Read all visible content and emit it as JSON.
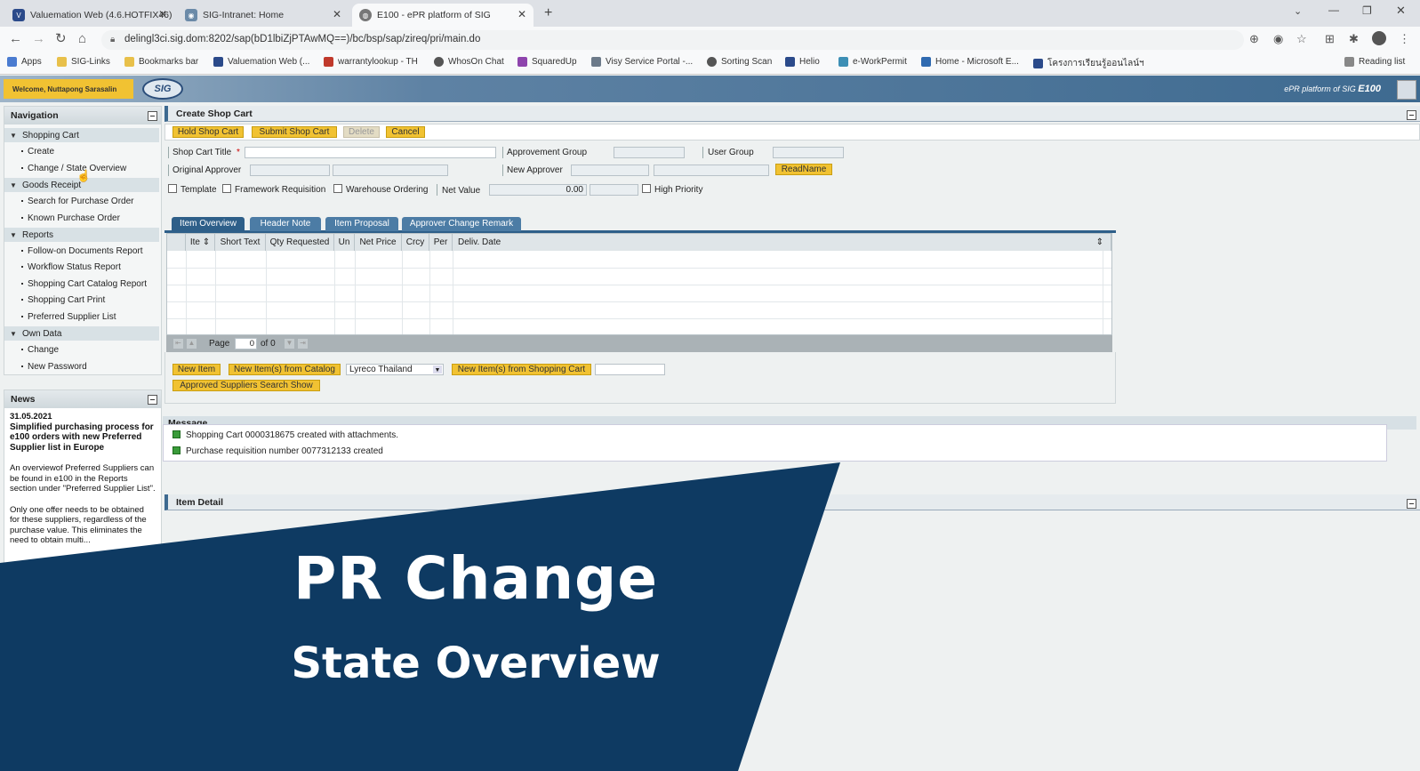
{
  "browser": {
    "tabs": [
      {
        "title": "Valuemation Web (4.6.HOTFIX46)",
        "favicon": "V"
      },
      {
        "title": "SIG-Intranet: Home",
        "favicon": "SIG"
      },
      {
        "title": "E100 - ePR platform of SIG",
        "favicon": "globe"
      }
    ],
    "url": "delingl3ci.sig.dom:8202/sap(bD1lbiZjPTAwMQ==)/bc/bsp/sap/zireq/pri/main.do",
    "bookmarks": [
      "Apps",
      "SIG-Links",
      "Bookmarks bar",
      "Valuemation Web (...",
      "warrantylookup - TH",
      "WhosOn Chat",
      "SquaredUp",
      "Visy Service Portal -...",
      "Sorting Scan",
      "Helio",
      "e-WorkPermit",
      "Home - Microsoft E...",
      "โครงการเรียนรู้ออนไลน์ฯ"
    ],
    "reading_list": "Reading list"
  },
  "header": {
    "welcome": "Welcome, Nuttapong Sarasalin",
    "logo": "SIG",
    "platform_prefix": "ePR platform of SIG",
    "platform_name": "E100"
  },
  "navigation": {
    "title": "Navigation",
    "groups": [
      {
        "label": "Shopping Cart",
        "items": [
          "Create",
          "Change / State Overview"
        ]
      },
      {
        "label": "Goods Receipt",
        "items": [
          "Search for Purchase Order",
          "Known Purchase Order"
        ]
      },
      {
        "label": "Reports",
        "items": [
          "Follow-on Documents Report",
          "Workflow Status Report",
          "Shopping Cart Catalog Report",
          "Shopping Cart Print",
          "Preferred Supplier List"
        ]
      },
      {
        "label": "Own Data",
        "items": [
          "Change",
          "New Password"
        ]
      }
    ]
  },
  "news": {
    "title": "News",
    "date": "31.05.2021",
    "headline": "Simplified purchasing process for e100 orders with new Preferred Supplier list in Europe",
    "para1": "An overviewof Preferred Suppliers can be found in e100 in the Reports section under \"Preferred Supplier List\".",
    "para2": "Only one offer needs to be obtained for these suppliers, regardless of the purchase value. This eliminates the need to obtain multi..."
  },
  "cart": {
    "title": "Create Shop Cart",
    "buttons": {
      "hold": "Hold Shop Cart",
      "submit": "Submit Shop Cart",
      "delete": "Delete",
      "cancel": "Cancel"
    },
    "fields": {
      "title_label": "Shop Cart Title",
      "required_mark": "*",
      "approvement_group": "Approvement Group",
      "user_group": "User Group",
      "original_approver": "Original Approver",
      "new_approver": "New Approver",
      "readname": "ReadName",
      "template": "Template",
      "framework": "Framework Requisition",
      "warehouse": "Warehouse Ordering",
      "net_value_label": "Net Value",
      "net_value": "0.00",
      "high_priority": "High Priority"
    },
    "tabs": [
      "Item Overview",
      "Header Note",
      "Item Proposal",
      "Approver Change Remark"
    ],
    "columns": [
      "Ite",
      "Short Text",
      "Qty Requested",
      "Un",
      "Net Price",
      "Crcy",
      "Per",
      "Deliv. Date"
    ],
    "pager": {
      "label": "Page",
      "page": "0",
      "of": "of 0"
    },
    "item_buttons": {
      "new_item": "New Item",
      "from_catalog": "New Item(s) from Catalog",
      "catalog_select": "Lyreco Thailand",
      "from_cart": "New Item(s) from Shopping Cart",
      "approved_suppliers": "Approved Suppliers Search Show"
    }
  },
  "messages": {
    "title": "Message",
    "items": [
      "Shopping Cart 0000318675 created with attachments.",
      "Purchase requisition number 0077312133 created"
    ]
  },
  "item_detail": {
    "title": "Item Detail"
  },
  "overlay": {
    "title": "PR Change",
    "subtitle": "State Overview",
    "color": "#0e3a62"
  }
}
